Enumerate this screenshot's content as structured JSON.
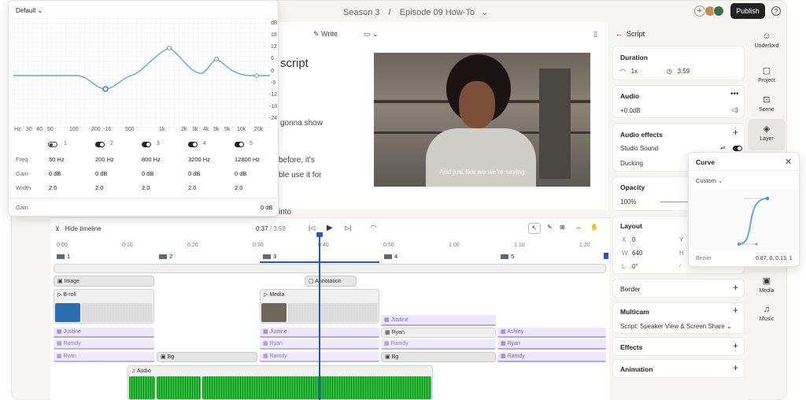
{
  "topbar": {
    "season": "Season 3",
    "separator": "/",
    "episode": "Episode 09 How-To",
    "publish_label": "Publish",
    "help_label": "?"
  },
  "editor": {
    "write_label": "Write",
    "heading": "script",
    "lines": [
      "gonna show",
      "before, it's",
      "ble use it for",
      "into"
    ]
  },
  "video": {
    "caption": "And just like we we're saying"
  },
  "inspector": {
    "back_title": "Script",
    "duration": {
      "title": "Duration",
      "speed": "1x",
      "time": "3:59"
    },
    "audio": {
      "title": "Audio",
      "gain": "+0.0dB"
    },
    "audio_effects": {
      "title": "Audio effects",
      "studio_sound": "Studio Sound",
      "ducking": "Ducking"
    },
    "opacity": {
      "title": "Opacity",
      "value": "100%"
    },
    "layout": {
      "title": "Layout",
      "x_label": "X",
      "x_value": "0",
      "y_label": "Y",
      "w_label": "W",
      "w_value": "640",
      "h_label": "H",
      "rot_label": "L",
      "rot_value": "0°"
    },
    "border": {
      "title": "Border"
    },
    "multicam": {
      "title": "Multicam",
      "value": "Script: Speaker View & Screen Share"
    },
    "effects": {
      "title": "Effects"
    },
    "animation": {
      "title": "Animation"
    }
  },
  "rail": [
    {
      "icon": "robot-icon",
      "glyph": "☺",
      "label": "Underlord"
    },
    {
      "icon": "folder-icon",
      "glyph": "▢",
      "label": "Project"
    },
    {
      "icon": "scene-icon",
      "glyph": "⊡",
      "label": "Scene"
    },
    {
      "icon": "layers-icon",
      "glyph": "◈",
      "label": "Layer"
    },
    {
      "icon": "media-icon",
      "glyph": "▣",
      "label": "Media"
    },
    {
      "icon": "music-icon",
      "glyph": "♫",
      "label": "Music"
    }
  ],
  "timeline": {
    "hide_label": "Hide timeline",
    "current_time": "0:37",
    "separator": "/",
    "total_time": "3:59",
    "ruler": [
      "0:00",
      "0:10",
      "0:20",
      "0:30",
      "0:40",
      "0:50",
      "1:00",
      "1:10",
      "1:20"
    ],
    "scenes": [
      "1",
      "2",
      "3",
      "4",
      "5"
    ],
    "clips": {
      "image": "Image",
      "annotation": "Annotation",
      "broll": "B-roll",
      "media": "Media",
      "bg1": "Bg",
      "bg2": "Bg",
      "audio": "Audio"
    },
    "speakers": {
      "justine": "Justine",
      "ramdy": "Ramdy",
      "ryan": "Ryan",
      "ashley": "Ashley"
    }
  },
  "eq": {
    "preset": "Default",
    "db_labels": [
      "dB",
      "18",
      "12",
      "6",
      "0",
      "-6",
      "-12",
      "-18",
      "-24"
    ],
    "freq_labels": [
      "Hz",
      "30",
      "40",
      "50",
      "100",
      "200",
      "-16",
      "500",
      "1k",
      "2k",
      "3k",
      "4k",
      "5k",
      "5k",
      "10k",
      "20k"
    ],
    "bands": [
      "1",
      "2",
      "3",
      "4",
      "5"
    ],
    "row_labels": {
      "freq": "Freq",
      "gain": "Gain",
      "width": "Width"
    },
    "freq": [
      "50 Hz",
      "200 Hz",
      "800 Hz",
      "3200 Hz",
      "12800 Hz"
    ],
    "gain": [
      "0 dB",
      "0 dB",
      "0 dB",
      "0 dB",
      "0 dB"
    ],
    "width": [
      "2.0",
      "2.0",
      "2.0",
      "2.0",
      "2.0"
    ],
    "footer_label": "Gain",
    "footer_value": "0 dB"
  },
  "curve": {
    "title": "Curve",
    "preset": "Custom",
    "type_label": "Bezier",
    "values": "0.87, 0, 0.13, 1"
  },
  "colors": {
    "accent": "#2456c8",
    "publish": "#222222",
    "audio_green": "#1ea42a",
    "curve": "#5aa9e6",
    "speaker_purple": "#7a5ec9"
  }
}
